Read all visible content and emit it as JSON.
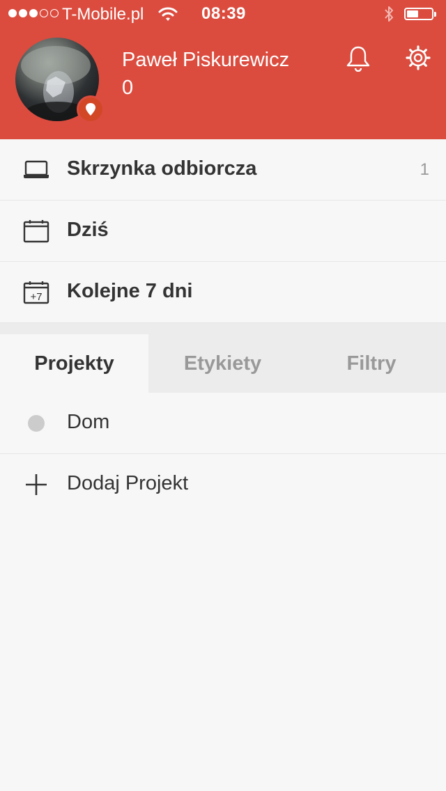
{
  "status_bar": {
    "carrier": "T-Mobile.pl",
    "time": "08:39",
    "signal_strength": 3,
    "signal_max": 5,
    "battery_level": 0.4
  },
  "header": {
    "user_name": "Paweł Piskurewicz",
    "karma": "0",
    "bell_icon": "bell-icon",
    "settings_icon": "gear-icon",
    "badge_icon": "location-pin-icon"
  },
  "nav": {
    "inbox": {
      "label": "Skrzynka odbiorcza",
      "count": "1",
      "icon": "inbox-tray-icon"
    },
    "today": {
      "label": "Dziś",
      "icon": "calendar-icon"
    },
    "next7": {
      "label": "Kolejne 7 dni",
      "icon": "calendar-plus7-icon",
      "icon_text": "+7"
    }
  },
  "tabs": [
    {
      "label": "Projekty",
      "active": true
    },
    {
      "label": "Etykiety",
      "active": false
    },
    {
      "label": "Filtry",
      "active": false
    }
  ],
  "projects": [
    {
      "label": "Dom",
      "color": "#cccccc"
    }
  ],
  "add_project": {
    "label": "Dodaj Projekt",
    "icon": "plus-icon"
  },
  "colors": {
    "brand": "#db4c3f",
    "background": "#f7f7f7",
    "tab_inactive_bg": "#ececec",
    "text": "#333333",
    "muted": "#999999"
  }
}
